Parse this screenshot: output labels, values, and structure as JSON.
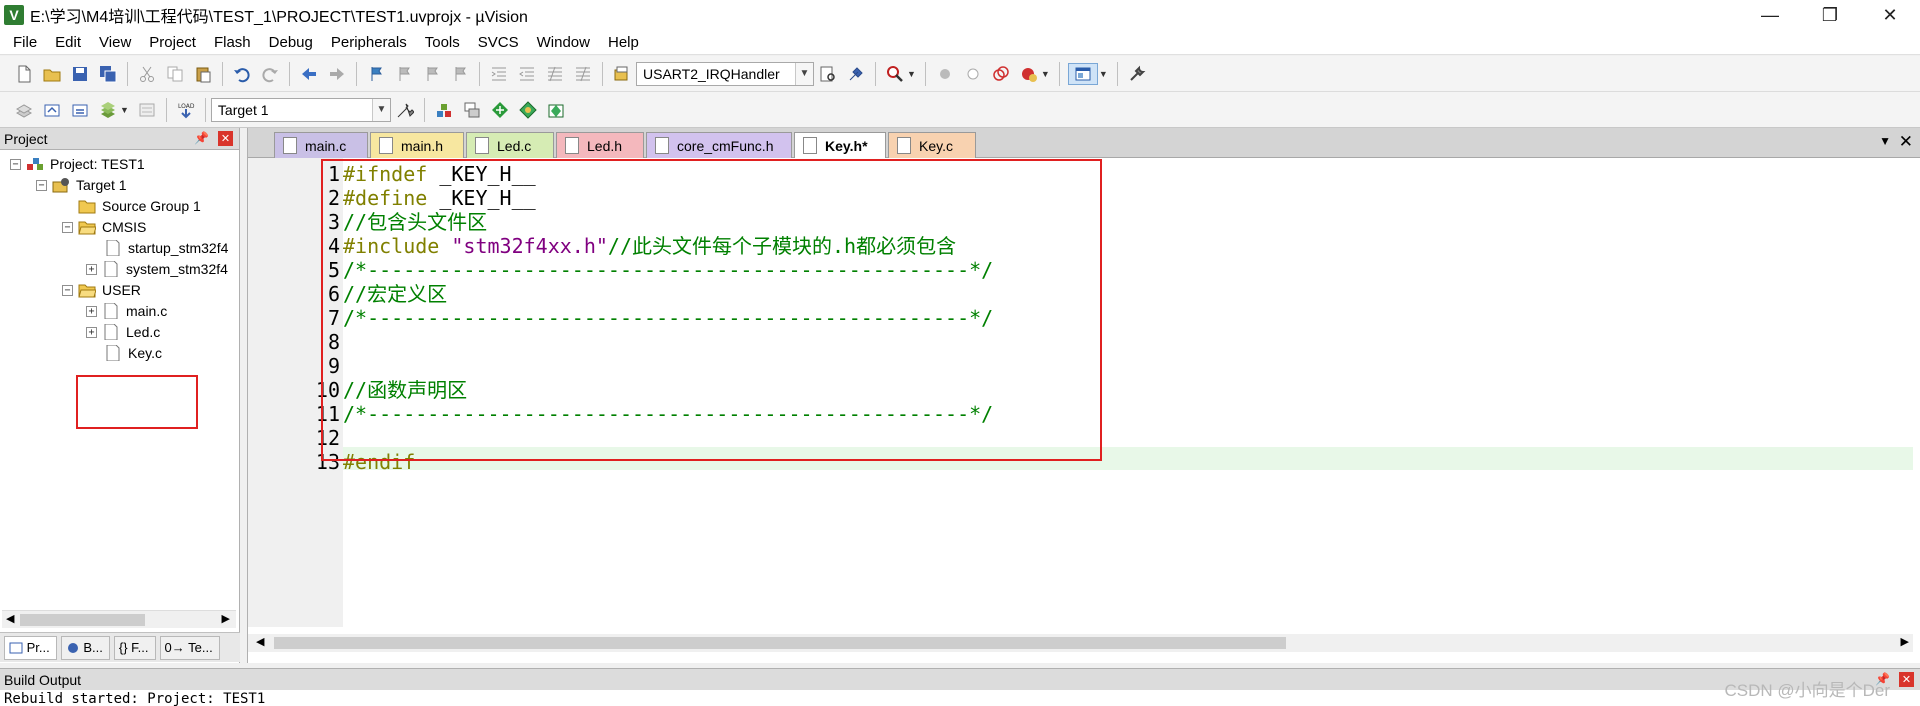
{
  "window": {
    "icon_letter": "V",
    "title": "E:\\学习\\M4培训\\工程代码\\TEST_1\\PROJECT\\TEST1.uvprojx - µVision",
    "minimize": "—",
    "restore": "❐",
    "close": "✕"
  },
  "menu": [
    "File",
    "Edit",
    "View",
    "Project",
    "Flash",
    "Debug",
    "Peripherals",
    "Tools",
    "SVCS",
    "Window",
    "Help"
  ],
  "toolbar": {
    "function_combo": "USART2_IRQHandler",
    "target_combo": "Target 1"
  },
  "project_panel": {
    "title": "Project",
    "pin": "📌",
    "close": "✕",
    "tree": [
      {
        "label": "Project: TEST1",
        "expander": "−"
      },
      {
        "label": "Target 1",
        "expander": "−"
      },
      {
        "label": "Source Group 1",
        "expander": ""
      },
      {
        "label": "CMSIS",
        "expander": "−"
      },
      {
        "label": "startup_stm32f4",
        "expander": ""
      },
      {
        "label": "system_stm32f4",
        "expander": "+"
      },
      {
        "label": "USER",
        "expander": "−"
      },
      {
        "label": "main.c",
        "expander": "+"
      },
      {
        "label": "Led.c",
        "expander": "+"
      },
      {
        "label": "Key.c",
        "expander": ""
      }
    ],
    "bottom_tabs": [
      "Pr...",
      "B...",
      "{} F...",
      "0→ Te..."
    ]
  },
  "editor": {
    "tabs": [
      {
        "label": "main.c",
        "color": "#c9c0e6"
      },
      {
        "label": "main.h",
        "color": "#f7e7a0"
      },
      {
        "label": "Led.c",
        "color": "#d6ecb4"
      },
      {
        "label": "Led.h",
        "color": "#f4b8bd"
      },
      {
        "label": "core_cmFunc.h",
        "color": "#d2c2ee"
      },
      {
        "label": "Key.h*",
        "color": "#ffffff"
      },
      {
        "label": "Key.c",
        "color": "#f8d2b0"
      }
    ],
    "code": [
      "#ifndef _KEY_H__",
      "#define _KEY_H__",
      "//包含头文件区",
      "#include \"stm32f4xx.h\"//此头文件每个子模块的.h都必须包含",
      "/*--------------------------------------------------*/",
      "//宏定义区",
      "/*--------------------------------------------------*/",
      "",
      "",
      "//函数声明区",
      "/*--------------------------------------------------*/",
      "",
      "#endif"
    ],
    "line_numbers": [
      "1",
      "2",
      "3",
      "4",
      "5",
      "6",
      "7",
      "8",
      "9",
      "10",
      "11",
      "12",
      "13"
    ],
    "colors": {
      "preprocessor": "#808000",
      "comment": "#008000",
      "string": "#800080",
      "plain": "#000000"
    }
  },
  "build_output": {
    "title": "Build Output",
    "line": "Rebuild started: Project: TEST1"
  },
  "watermark": "CSDN @小向是个Der"
}
